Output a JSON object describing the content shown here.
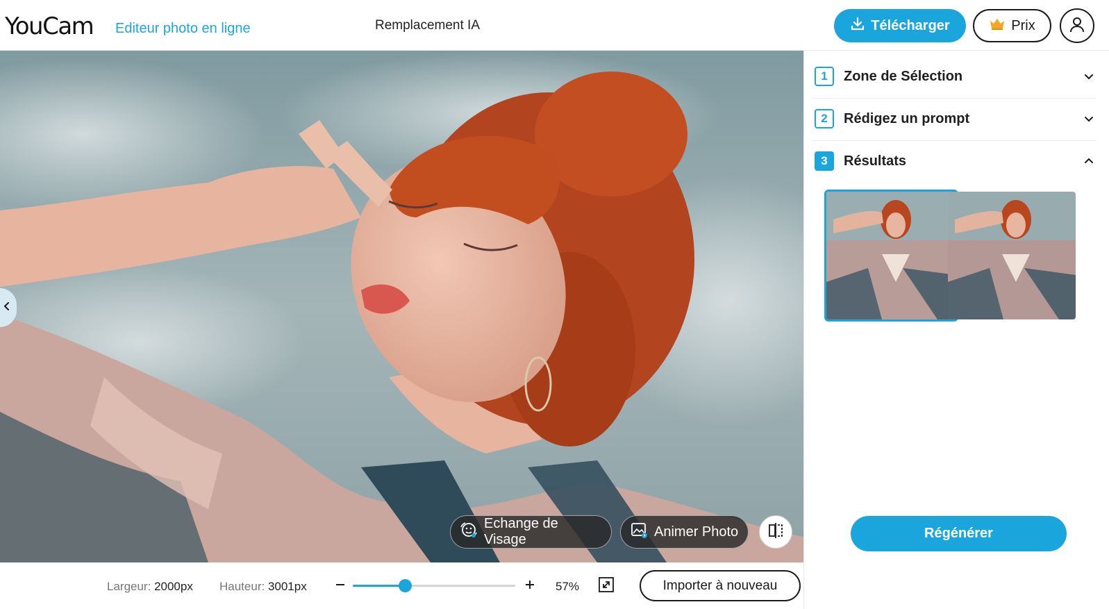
{
  "header": {
    "logo": "YouCam",
    "logo_subtitle": "Editeur photo en ligne",
    "feature_title": "Remplacement IA",
    "download_label": "Télécharger",
    "prix_label": "Prix"
  },
  "canvas": {
    "face_swap_label": "Echange de Visage",
    "animate_label": "Animer Photo"
  },
  "bottom_bar": {
    "width_label": "Largeur:",
    "width_value": "2000px",
    "height_label": "Hauteur:",
    "height_value": "3001px",
    "zoom_minus": "−",
    "zoom_plus": "+",
    "zoom_value": "57%",
    "zoom_fraction": 0.32,
    "reimport_label": "Importer à nouveau"
  },
  "panel": {
    "steps": [
      {
        "number": "1",
        "label": "Zone de Sélection",
        "expanded": false
      },
      {
        "number": "2",
        "label": "Rédigez un prompt",
        "expanded": false
      },
      {
        "number": "3",
        "label": "Résultats",
        "expanded": true
      }
    ],
    "results_count": 2,
    "regenerate_label": "Régénérer"
  },
  "colors": {
    "accent": "#1aa5dd",
    "text": "#1f1f1f",
    "muted": "#777777"
  },
  "icons": [
    "download-icon",
    "crown-icon",
    "user-icon",
    "chevron-left-icon",
    "face-swap-icon",
    "animate-photo-icon",
    "compare-icon",
    "fullscreen-icon",
    "chevron-down-icon",
    "chevron-up-icon"
  ]
}
